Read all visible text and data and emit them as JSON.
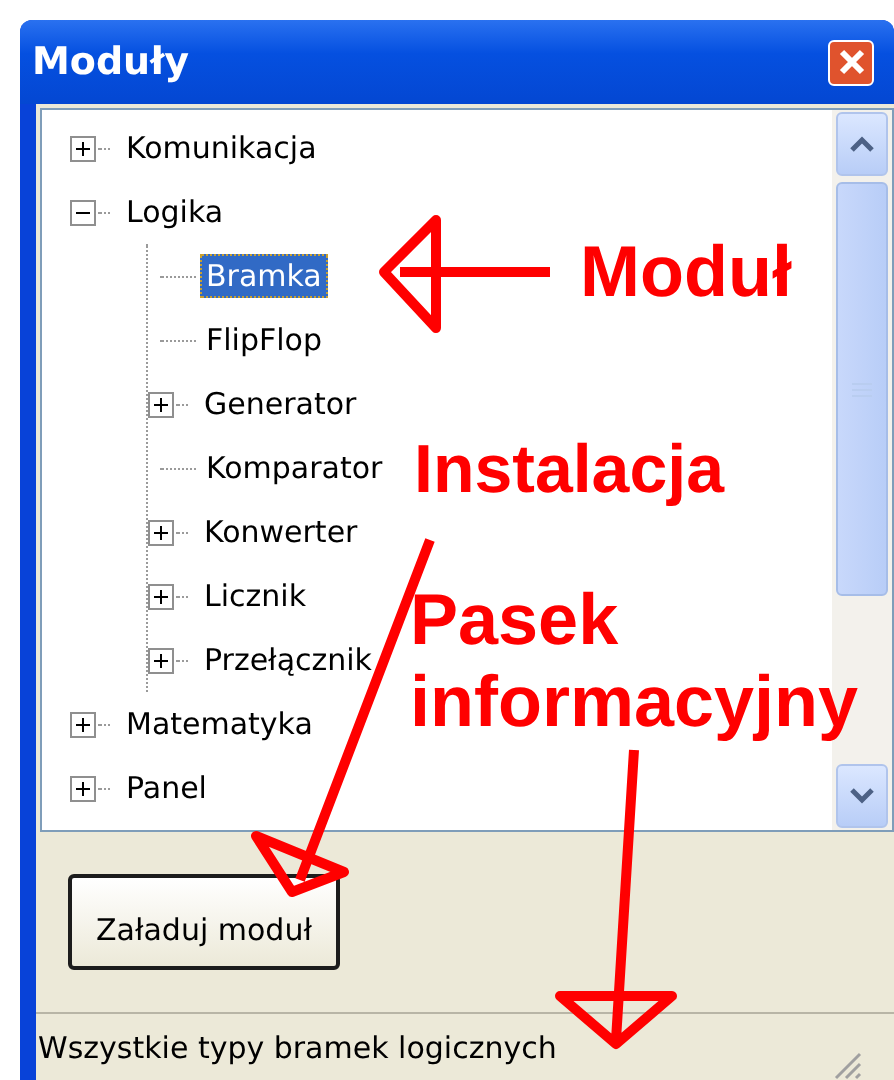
{
  "window": {
    "title": "Moduły"
  },
  "tree": [
    {
      "label": "Komunikacja",
      "kind": "group",
      "expanded": false,
      "selected": false
    },
    {
      "label": "Logika",
      "kind": "group",
      "expanded": true,
      "selected": false,
      "children": [
        {
          "label": "Bramka",
          "kind": "leaf",
          "selected": true
        },
        {
          "label": "FlipFlop",
          "kind": "leaf",
          "selected": false
        },
        {
          "label": "Generator",
          "kind": "group",
          "expanded": false,
          "selected": false
        },
        {
          "label": "Komparator",
          "kind": "leaf",
          "selected": false
        },
        {
          "label": "Konwerter",
          "kind": "group",
          "expanded": false,
          "selected": false
        },
        {
          "label": "Licznik",
          "kind": "group",
          "expanded": false,
          "selected": false
        },
        {
          "label": "Przełącznik",
          "kind": "group",
          "expanded": false,
          "selected": false
        }
      ]
    },
    {
      "label": "Matematyka",
      "kind": "group",
      "expanded": false,
      "selected": false
    },
    {
      "label": "Panel",
      "kind": "group",
      "expanded": false,
      "selected": false
    }
  ],
  "buttons": [
    "Załaduj moduł"
  ],
  "status_bar": "Wszystkie typy bramek logicznych",
  "annotations": [
    {
      "text": "Moduł"
    },
    {
      "text": "Instalacja"
    },
    {
      "text": "Pasek"
    },
    {
      "text": "informacyjny"
    }
  ]
}
